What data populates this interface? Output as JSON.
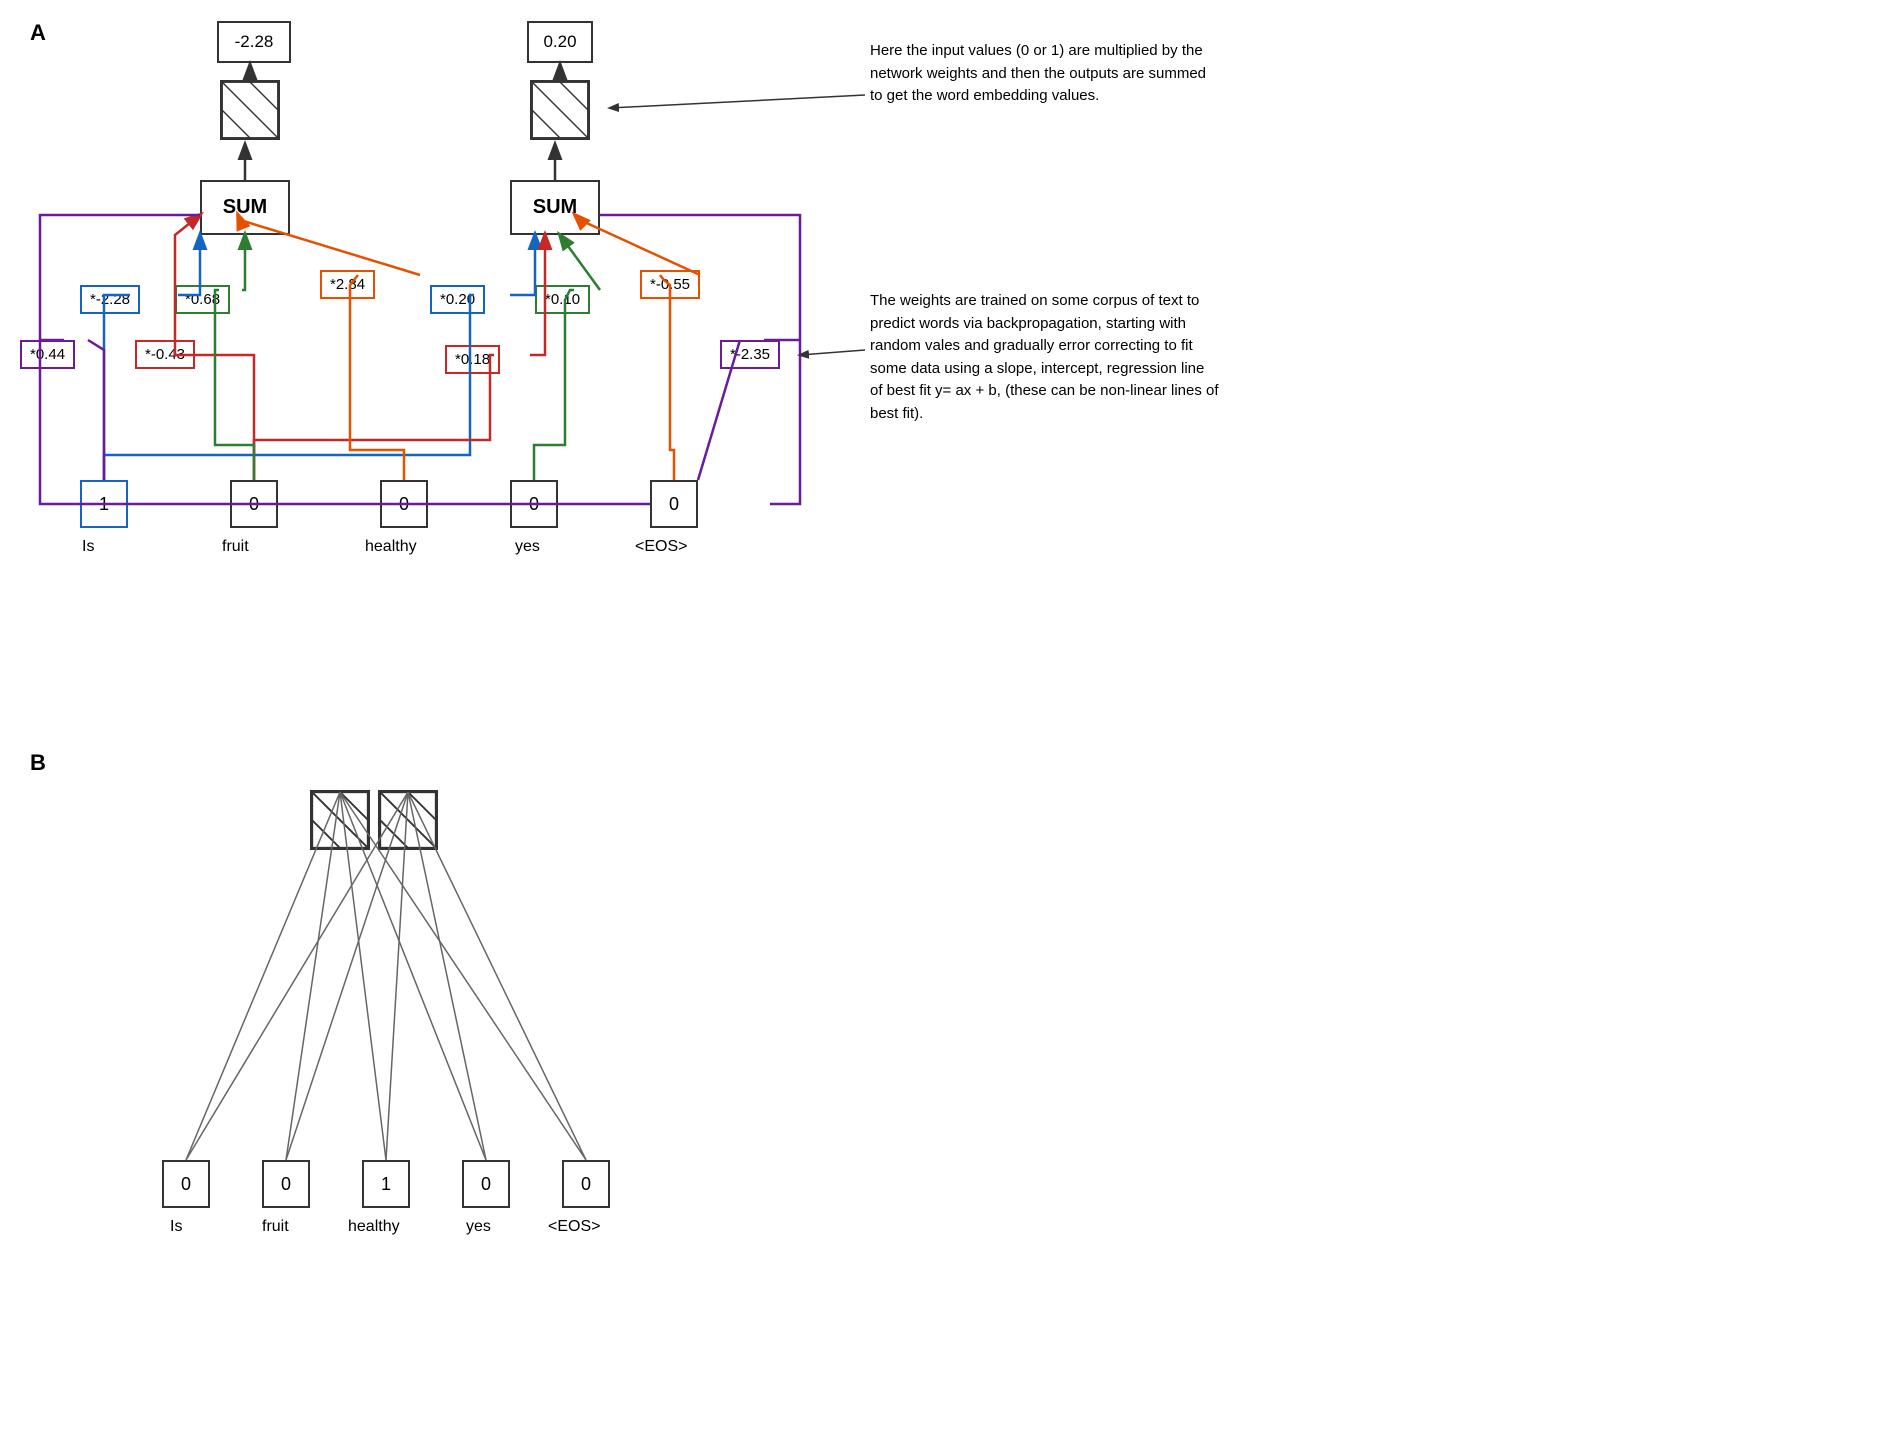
{
  "sectionA": {
    "label": "A",
    "output1_value": "-2.28",
    "output2_value": "0.20",
    "sum1_label": "SUM",
    "sum2_label": "SUM",
    "weights": {
      "w1": "*-2.28",
      "w2": "*0.68",
      "w3": "*0.44",
      "w4": "*-0.43",
      "w5": "*2.84",
      "w6": "*0.20",
      "w7": "*0.10",
      "w8": "*0.18",
      "w9": "*-0.55",
      "w10": "*-2.35"
    },
    "inputs": {
      "is_val": "1",
      "fruit_val": "0",
      "healthy_val": "0",
      "yes_val": "0",
      "eos_val": "0"
    },
    "input_labels": {
      "is": "Is",
      "fruit": "fruit",
      "healthy": "healthy",
      "yes": "yes",
      "eos": "<EOS>"
    },
    "annotation1": "Here the input values (0 or 1) are multiplied by the network weights and then the outputs are summed to get the word embedding values.",
    "annotation2": "The weights are trained on some corpus of text to predict words via backpropagation, starting with random vales and gradually error correcting to fit some data using a slope, intercept, regression line of best fit y= ax  + b, (these can be non-linear lines of best fit)."
  },
  "sectionB": {
    "label": "B",
    "inputs": {
      "is_val": "0",
      "fruit_val": "0",
      "healthy_val": "1",
      "yes_val": "0",
      "eos_val": "0"
    },
    "input_labels": {
      "is": "Is",
      "fruit": "fruit",
      "healthy": "healthy",
      "yes": "yes",
      "eos": "<EOS>"
    }
  }
}
